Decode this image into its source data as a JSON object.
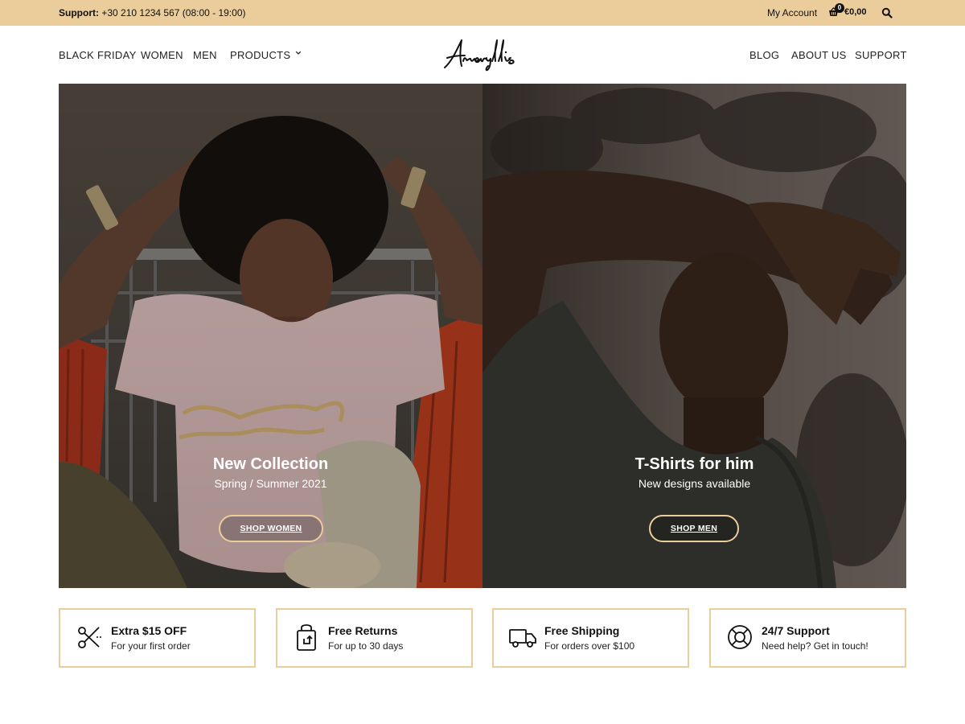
{
  "topbar": {
    "support_label": "Support:",
    "support_text": "+30 210 1234 567 (08:00 - 19:00)",
    "account_label": "My Account",
    "cart_count": "0",
    "cart_total": "€0,00",
    "cart_icon": "basket-icon",
    "search_icon": "search-icon",
    "background": "#ebcd9b"
  },
  "header": {
    "logo_text": "Amaryllis",
    "nav_left": [
      {
        "label": "BLACK FRIDAY"
      },
      {
        "label": "WOMEN"
      },
      {
        "label": "MEN"
      },
      {
        "label": "PRODUCTS"
      }
    ],
    "nav_right": [
      {
        "label": "BLOG"
      },
      {
        "label": "ABOUT US"
      },
      {
        "label": "SUPPORT"
      }
    ]
  },
  "hero": {
    "panels": [
      {
        "title": "New Collection",
        "subtitle": "Spring / Summer 2021",
        "button": "SHOP WOMEN"
      },
      {
        "title": "T-Shirts for him",
        "subtitle": "New designs available",
        "button": "SHOP MEN"
      }
    ],
    "button_border_color": "#ebcd9b"
  },
  "features": [
    {
      "icon": "scissors-icon",
      "title": "Extra $15 OFF",
      "subtitle": "For your first order"
    },
    {
      "icon": "shopping-bag-return-icon",
      "title": "Free Returns",
      "subtitle": "For up to 30 days"
    },
    {
      "icon": "delivery-truck-icon",
      "title": "Free Shipping",
      "subtitle": "For orders over $100"
    },
    {
      "icon": "lifebuoy-icon",
      "title": "24/7 Support",
      "subtitle": "Need help? Get in touch!"
    }
  ],
  "colors": {
    "accent": "#ebcd9b"
  }
}
